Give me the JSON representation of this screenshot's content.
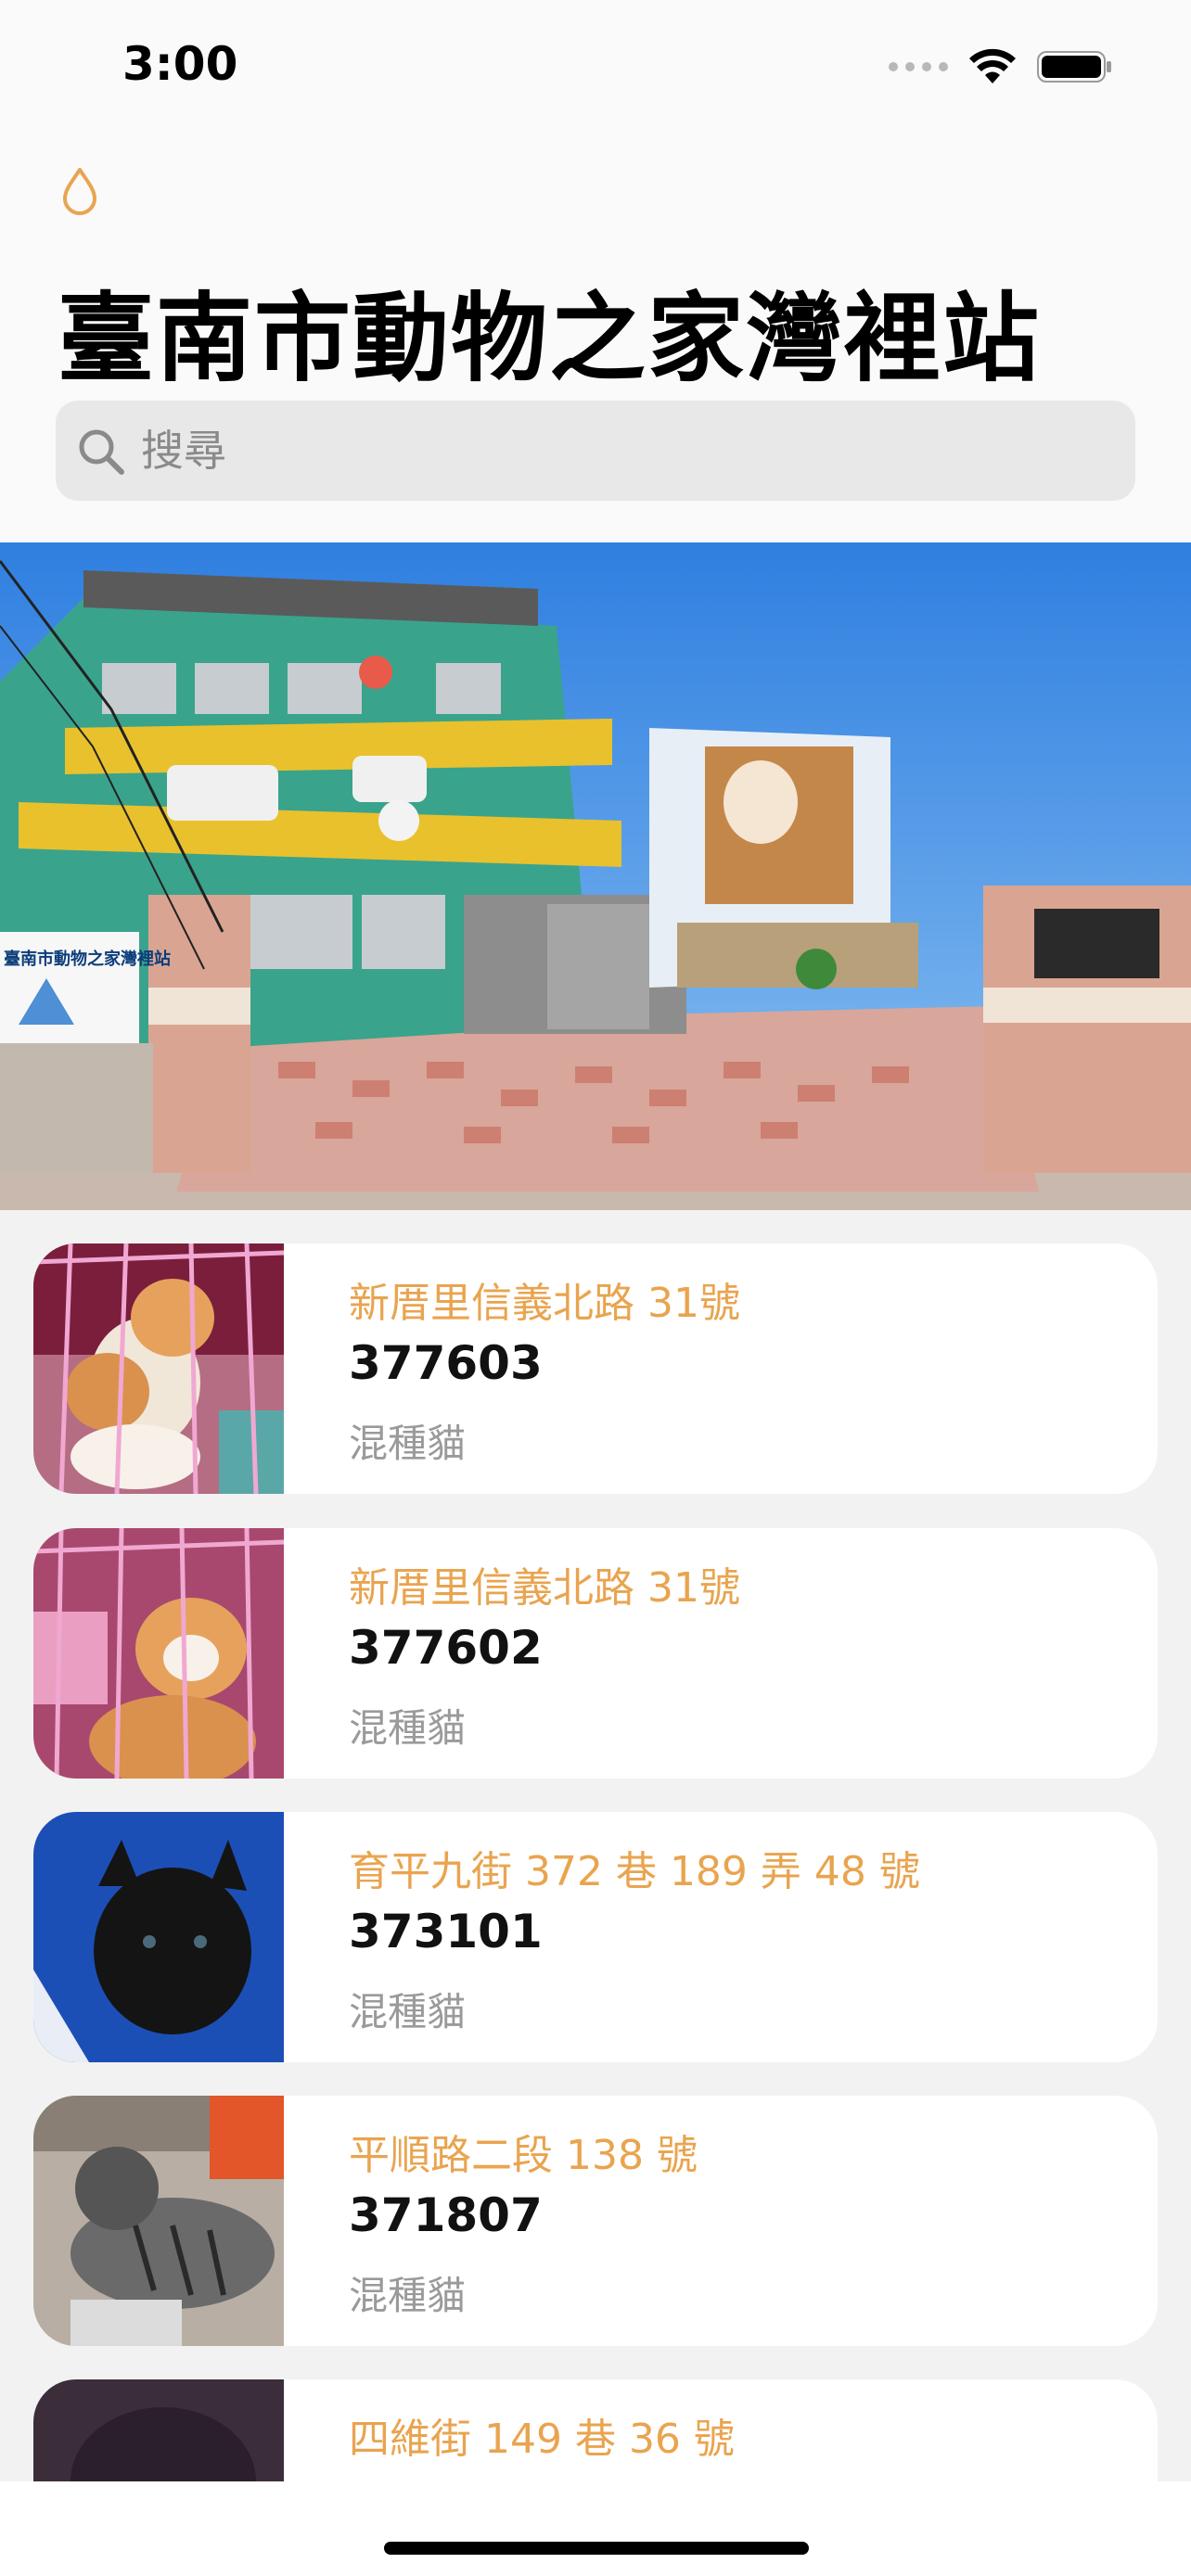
{
  "status": {
    "time": "3:00"
  },
  "header": {
    "title": "臺南市動物之家灣裡站",
    "accent_color": "#e9a44f"
  },
  "search": {
    "placeholder": "搜尋",
    "value": ""
  },
  "hero": {
    "sign_text": "臺南市動物之家灣裡站"
  },
  "animals": [
    {
      "address": "新厝里信義北路 31號",
      "id": "377603",
      "kind": "混種貓"
    },
    {
      "address": "新厝里信義北路 31號",
      "id": "377602",
      "kind": "混種貓"
    },
    {
      "address": "育平九街 372 巷 189 弄 48 號",
      "id": "373101",
      "kind": "混種貓"
    },
    {
      "address": "平順路二段 138 號",
      "id": "371807",
      "kind": "混種貓"
    },
    {
      "address": "四維街 149 巷 36 號",
      "id": "",
      "kind": ""
    }
  ],
  "icons": {
    "drop": "drop-icon",
    "search": "search-icon",
    "wifi": "wifi-icon",
    "battery": "battery-icon",
    "signal": "signal-icon"
  }
}
